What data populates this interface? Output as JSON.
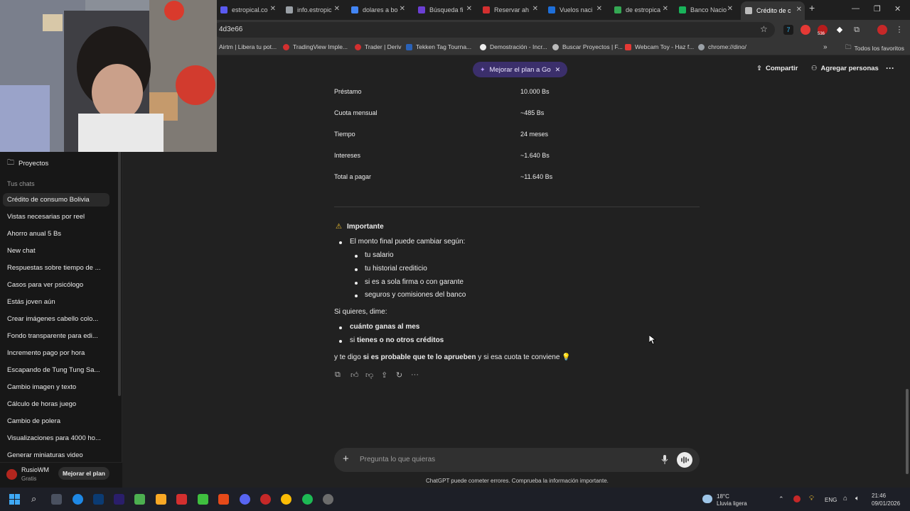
{
  "browser": {
    "tabs": [
      {
        "title": "estropical.co",
        "color": "#5a5af0"
      },
      {
        "title": "info.estropic",
        "color": "#9aa0a6"
      },
      {
        "title": "dolares a bo",
        "color": "#4285f4"
      },
      {
        "title": "Búsqueda fi",
        "color": "#6b3fd4"
      },
      {
        "title": "Reservar ah",
        "color": "#d32f2f"
      },
      {
        "title": "Vuelos naci",
        "color": "#1e6fd9"
      },
      {
        "title": "de estropica",
        "color": "#34a853"
      },
      {
        "title": "Banco Nacio",
        "color": "#19b35a"
      },
      {
        "title": "Crédito de c",
        "color": "#bbbbbb"
      }
    ],
    "new_tab": "+",
    "url": "4d3e66",
    "extension_badge": "536",
    "bookmarks": [
      {
        "label": "Airtm | Libera tu pot...",
        "color": "#2c6bed"
      },
      {
        "label": "TradingView Imple...",
        "color": "#d32f2f"
      },
      {
        "label": "Trader | Deriv",
        "color": "#d32f2f"
      },
      {
        "label": "Tekken Tag Tourna...",
        "color": "#2a62b8"
      },
      {
        "label": "Demostración - Incr...",
        "color": "#ffffff"
      },
      {
        "label": "Buscar Proyectos | F...",
        "color": "#cccccc"
      },
      {
        "label": "Webcam Toy - Haz f...",
        "color": "#e53935"
      },
      {
        "label": "chrome://dino/",
        "color": "#9aa0a6"
      }
    ],
    "all_bookmarks": "Todos los favoritos"
  },
  "sidebar": {
    "projects": "Proyectos",
    "section": "Tus chats",
    "chats": [
      "Crédito de consumo Bolivia",
      "Vistas necesarias por reel",
      "Ahorro anual 5 Bs",
      "New chat",
      "Respuestas sobre tiempo de ...",
      "Casos para ver psicólogo",
      "Estás joven aún",
      "Crear imágenes cabello colo...",
      "Fondo transparente para edi...",
      "Incremento pago por hora",
      "Escapando de Tung Tung Sa...",
      "Cambio imagen y texto",
      "Cálculo de horas juego",
      "Cambio de polera",
      "Visualizaciones para 4000 ho...",
      "Generar miniaturas video"
    ],
    "user_name": "RusioWM",
    "user_plan": "Gratis",
    "upgrade": "Mejorar el plan"
  },
  "header": {
    "upgrade_pill": "Mejorar el plan a Go",
    "share": "Compartir",
    "add_people": "Agregar personas",
    "more": "···"
  },
  "table": [
    {
      "label": "Préstamo",
      "value": "10.000 Bs"
    },
    {
      "label": "Cuota mensual",
      "value": "~485 Bs"
    },
    {
      "label": "Tiempo",
      "value": "24 meses"
    },
    {
      "label": "Intereses",
      "value": "~1.640 Bs"
    },
    {
      "label": "Total a pagar",
      "value": "~11.640 Bs"
    }
  ],
  "message": {
    "important_icon": "⚠",
    "important": "Importante",
    "bullet1": "El monto final puede cambiar según:",
    "sub": [
      "tu salario",
      "tu historial crediticio",
      "si es a sola firma o con garante",
      "seguros y comisiones del banco"
    ],
    "ask": "Si quieres, dime:",
    "q1": "cuánto ganas al mes",
    "q2_pre": "si ",
    "q2_bold": "tienes o no otros créditos",
    "closing_pre": "y te digo ",
    "closing_bold": "si es probable que te lo aprueben",
    "closing_post": " y si esa cuota te conviene 💡"
  },
  "composer": {
    "placeholder": "Pregunta lo que quieras",
    "disclaimer": "ChatGPT puede cometer errores. Comprueba la información importante."
  },
  "taskbar": {
    "weather_temp": "18°C",
    "weather_desc": "Lluvia ligera",
    "lang": "ENG",
    "time": "21:46",
    "date": "09/01/2026"
  }
}
